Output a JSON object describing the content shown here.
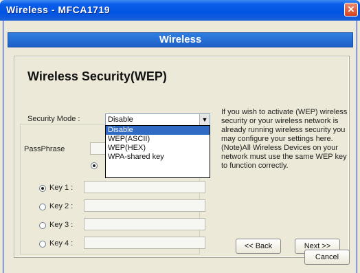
{
  "window": {
    "title": "Wireless - MFCA1719",
    "close_label": "✕"
  },
  "banner": {
    "title": "Wireless"
  },
  "security": {
    "heading": "Wireless Security(WEP)",
    "mode_label": "Security Mode :",
    "mode_value": "Disable",
    "options": [
      "Disable",
      "WEP(ASCII)",
      "WEP(HEX)",
      "WPA-shared key"
    ],
    "passphrase_label": "PassPhrase"
  },
  "keys": [
    {
      "label": "Key 1 :",
      "checked": true
    },
    {
      "label": "Key 2 :",
      "checked": false
    },
    {
      "label": "Key 3 :",
      "checked": false
    },
    {
      "label": "Key 4 :",
      "checked": false
    }
  ],
  "help_text": "If you wish to activate (WEP) wireless security or your wireless network is already running wireless security you may configure your settings here. (Note)All Wireless Devices on your network must use the same WEP key to function correctly.",
  "buttons": {
    "back": "<< Back",
    "next": "Next >>",
    "cancel": "Cancel"
  },
  "icons": {
    "close": "close-icon",
    "dropdown": "chevron-down-icon"
  }
}
